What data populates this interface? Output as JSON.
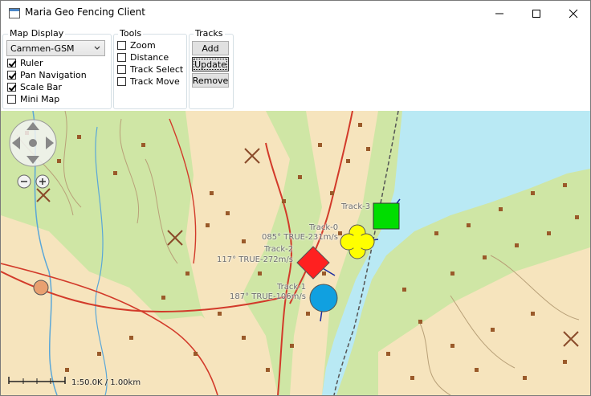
{
  "window": {
    "title": "Maria Geo Fencing Client",
    "icon": "app-window-icon"
  },
  "map_display": {
    "label": "Map Display",
    "map_select": {
      "value": "Carnmen-GSM"
    },
    "options": [
      {
        "label": "Ruler",
        "checked": true
      },
      {
        "label": "Pan Navigation",
        "checked": true
      },
      {
        "label": "Scale Bar",
        "checked": true
      },
      {
        "label": "Mini Map",
        "checked": false
      }
    ]
  },
  "tools": {
    "label": "Tools",
    "options": [
      {
        "label": "Zoom",
        "checked": false
      },
      {
        "label": "Distance",
        "checked": false
      },
      {
        "label": "Track Select",
        "checked": false
      },
      {
        "label": "Track Move",
        "checked": false
      }
    ]
  },
  "tracks_panel": {
    "label": "Tracks",
    "add_label": "Add",
    "update_label": "Update",
    "remove_label": "Remove"
  },
  "map": {
    "tracks": [
      {
        "name": "Track-3",
        "info": "",
        "shape": "square",
        "color": "#00dd00"
      },
      {
        "name": "Track-0",
        "info": "085° TRUE-231m/s",
        "shape": "quatrefoil",
        "color": "#ffff00"
      },
      {
        "name": "Track-2",
        "info": "117° TRUE-272m/s",
        "shape": "diamond",
        "color": "#ff2020"
      },
      {
        "name": "Track-1",
        "info": "187° TRUE-106m/s",
        "shape": "circle",
        "color": "#10a0e0"
      }
    ],
    "scale_text": "1:50.0K / 1.00km",
    "colors": {
      "water": "#b9e9f4",
      "forest": "#cfe6a5",
      "open_land": "#f6e4bd",
      "road": "#d23a2a",
      "building": "#9a5a2a"
    }
  }
}
